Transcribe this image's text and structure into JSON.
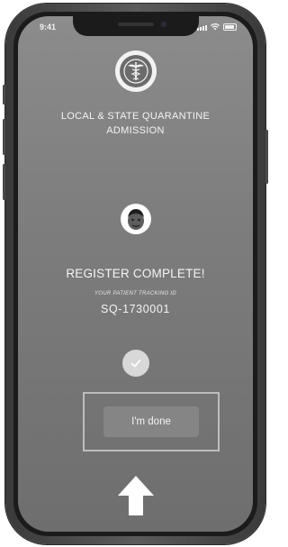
{
  "status_bar": {
    "time": "9:41"
  },
  "header": {
    "logo_icon": "department-seal-icon",
    "title": "LOCAL & STATE QUARANTINE ADMISSION"
  },
  "profile": {
    "avatar_icon": "memoji-avatar-icon"
  },
  "result": {
    "heading": "REGISTER COMPLETE!",
    "tracking_label": "YOUR PATIENT TRACKING ID",
    "tracking_id": "SQ-1730001",
    "status_icon": "check-icon"
  },
  "actions": {
    "done_label": "I'm done",
    "hint_icon": "up-arrow-icon"
  },
  "colors": {
    "screen_bg": "#7d7d7d",
    "text": "#f4f4f4",
    "button_bg": "#858585",
    "frame": "#bdbdbd"
  }
}
